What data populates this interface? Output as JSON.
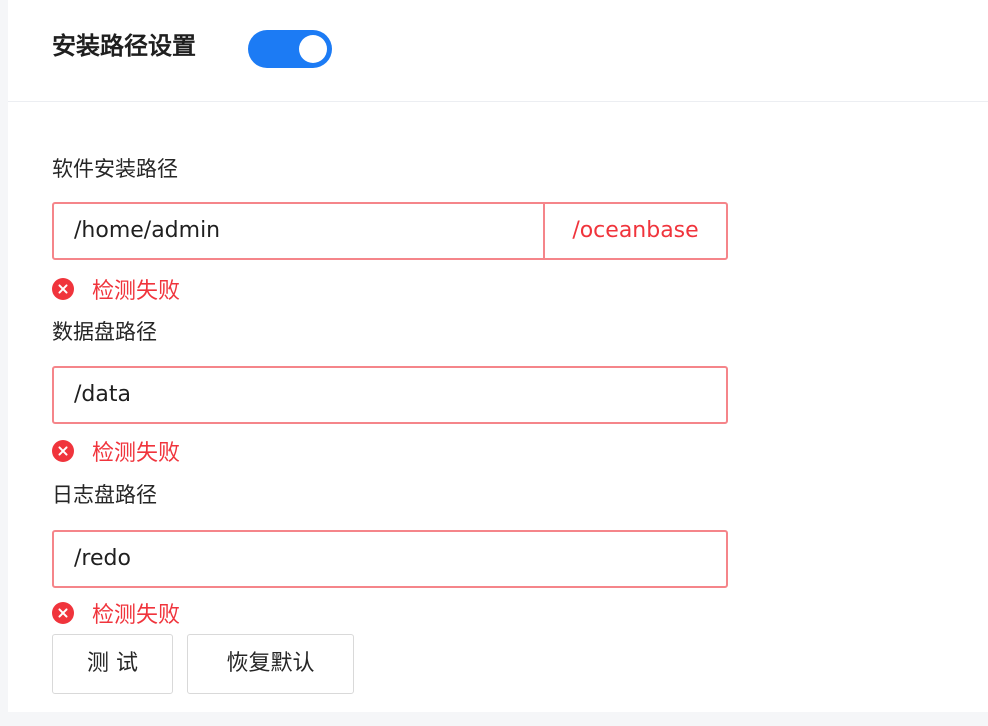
{
  "header": {
    "title": "安装路径设置",
    "toggle_on": true
  },
  "fields": [
    {
      "label": "软件安装路径",
      "value": "/home/admin",
      "suffix": "/oceanbase",
      "error": "检测失败"
    },
    {
      "label": "数据盘路径",
      "value": "/data",
      "error": "检测失败"
    },
    {
      "label": "日志盘路径",
      "value": "/redo",
      "error": "检测失败"
    }
  ],
  "buttons": {
    "test": "测 试",
    "reset": "恢复默认"
  },
  "colors": {
    "accent": "#1c7bf4",
    "error": "#f0343c",
    "error_border": "#f5858a"
  }
}
